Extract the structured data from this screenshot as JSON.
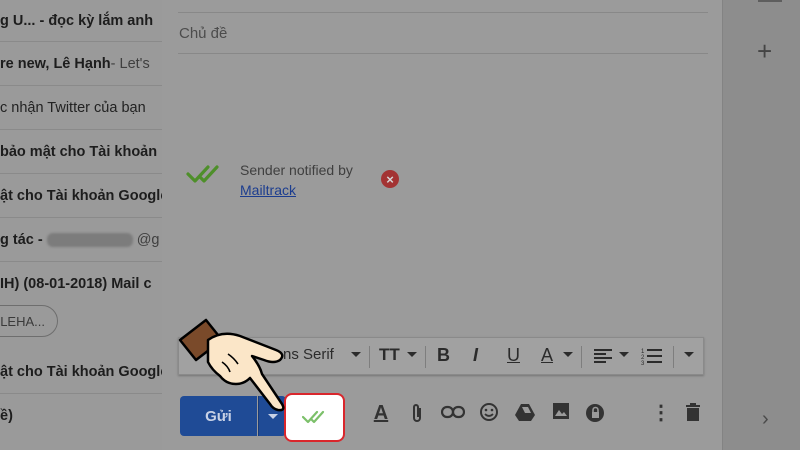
{
  "inbox": {
    "rows": [
      {
        "sender": "g U... - đọc kỳ lắm anh",
        "snippet": ""
      },
      {
        "sender": "re new, Lê Hạnh",
        "snippet": " - Let's"
      },
      {
        "sender": "",
        "snippet": "c nhận Twitter của bạn"
      },
      {
        "sender": " bảo mật cho Tài khoản",
        "snippet": ""
      },
      {
        "sender": "ật cho Tài khoản Google",
        "snippet": ""
      },
      {
        "sender": "g tác - ",
        "snippet": "@g"
      },
      {
        "sender": "IH) (08-01-2018) Mail c",
        "snippet": ""
      },
      {
        "sender": "",
        "snippet": ""
      },
      {
        "sender": "ật cho Tài khoản Google",
        "snippet": ""
      },
      {
        "sender": "ề)",
        "snippet": ""
      }
    ],
    "chip_label": "LEHA..."
  },
  "compose": {
    "subject_placeholder": "Chủ đề",
    "mailtrack": {
      "text": "Sender notified by",
      "link": "Mailtrack"
    },
    "toolbar": {
      "font": "ns Serif"
    },
    "send_label": "Gửi"
  },
  "colors": {
    "send_blue": "#1f4b96",
    "highlight_red": "#d9262c",
    "mailtrack_green": "#5aa02c"
  }
}
